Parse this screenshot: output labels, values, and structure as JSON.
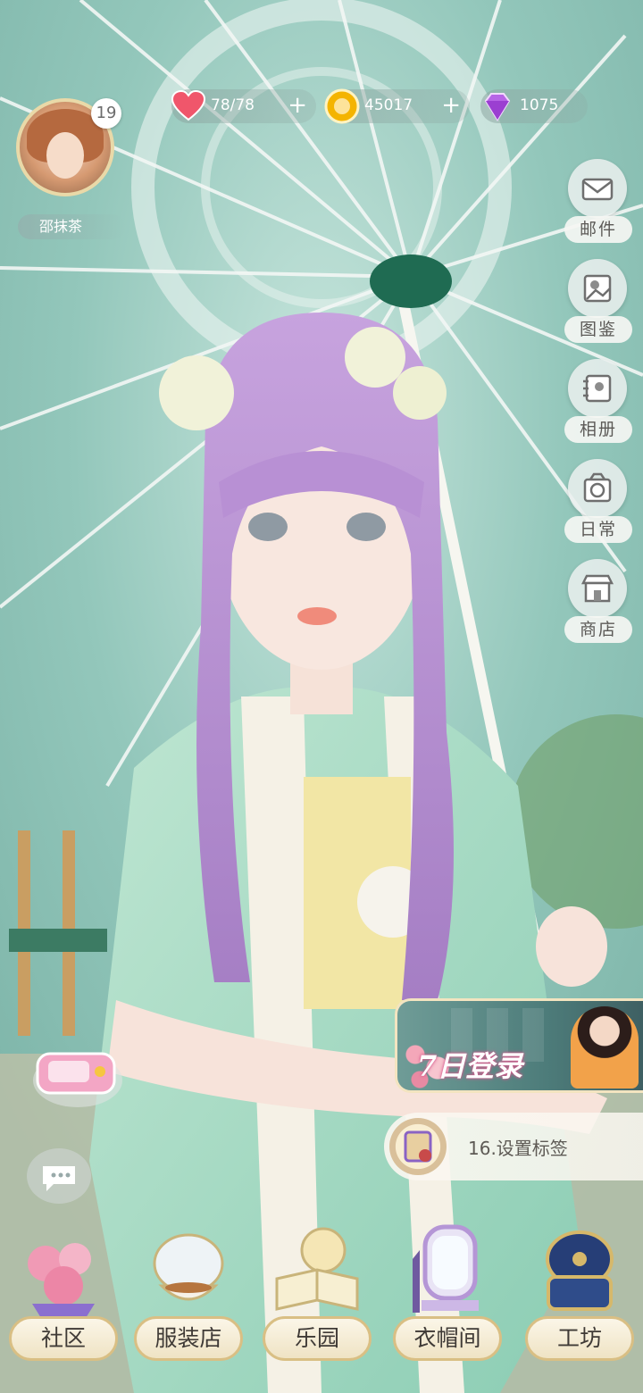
{
  "player": {
    "name": "邵抹茶",
    "level": "19"
  },
  "resources": {
    "stamina": "78/78",
    "coins": "45017",
    "gems": "1075",
    "plus": "+"
  },
  "side_menu": [
    "邮件",
    "图鉴",
    "相册",
    "日常",
    "商店"
  ],
  "banner": {
    "title": "7日登录"
  },
  "task": {
    "text": "16.设置标签"
  },
  "bottom_nav": [
    "社区",
    "服装店",
    "乐园",
    "衣帽间",
    "工坊"
  ],
  "colors": {
    "accent_gold": "#d9bf84",
    "teal": "#5f9f95",
    "hair": "#b48bd0"
  }
}
